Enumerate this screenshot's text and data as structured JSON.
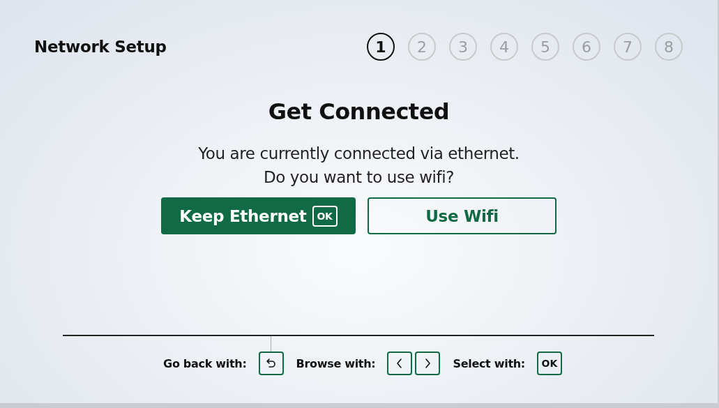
{
  "title": "Network Setup",
  "steps": [
    {
      "label": "1",
      "selected": true
    },
    {
      "label": "2",
      "selected": false
    },
    {
      "label": "3",
      "selected": false
    },
    {
      "label": "4",
      "selected": false
    },
    {
      "label": "5",
      "selected": false
    },
    {
      "label": "6",
      "selected": false
    },
    {
      "label": "7",
      "selected": false
    },
    {
      "label": "8",
      "selected": false
    }
  ],
  "heading": "Get Connected",
  "message": [
    "You are currently connected via ethernet.",
    "Do you want to use wifi?"
  ],
  "buttons": [
    {
      "label": "Keep Ethernet",
      "kind": "primary",
      "key": "OK"
    },
    {
      "label": "Use Wifi",
      "kind": "secondary"
    }
  ],
  "hints": [
    {
      "label": "Go back with:",
      "keys": [
        {
          "kind": "back"
        }
      ]
    },
    {
      "label": "Browse with:",
      "keys": [
        {
          "kind": "left"
        },
        {
          "kind": "right"
        }
      ]
    },
    {
      "label": "Select with:",
      "keys": [
        {
          "kind": "text",
          "text": "OK"
        }
      ]
    }
  ]
}
